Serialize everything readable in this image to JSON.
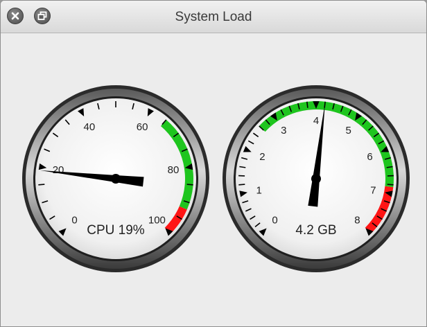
{
  "window": {
    "title": "System Load"
  },
  "toolbar": {
    "close_icon": "close-icon",
    "restore_icon": "restore-icon"
  },
  "gauges": [
    {
      "name": "cpu",
      "readout": "CPU 19%",
      "tick_labels": [
        "0",
        "20",
        "40",
        "60",
        "80",
        "100"
      ],
      "value": 19,
      "min": 0,
      "max": 100,
      "zones": [
        {
          "from": 65,
          "to": 92,
          "color": "#1ec51e"
        },
        {
          "from": 92,
          "to": 100,
          "color": "#ff1515"
        }
      ]
    },
    {
      "name": "memory",
      "readout": "4.2 GB",
      "tick_labels": [
        "0",
        "1",
        "2",
        "3",
        "4",
        "5",
        "6",
        "7",
        "8"
      ],
      "value": 4.2,
      "min": 0,
      "max": 8,
      "zones": [
        {
          "from": 2.6,
          "to": 6.85,
          "color": "#1ec51e"
        },
        {
          "from": 6.85,
          "to": 8,
          "color": "#ff1515"
        }
      ]
    }
  ],
  "colors": {
    "green_zone": "#1ec51e",
    "red_zone": "#ff1515",
    "needle": "#000000"
  }
}
